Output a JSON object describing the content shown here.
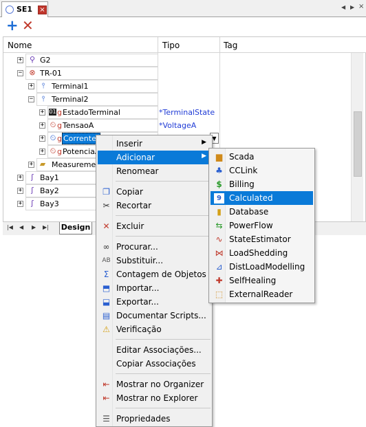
{
  "document_tab": {
    "title": "SE1",
    "close": "×"
  },
  "toolbar": {
    "add": "+",
    "delete": "✕"
  },
  "grid": {
    "columns": [
      "Nome",
      "Tipo",
      "Tag"
    ],
    "rows": [
      {
        "name": "G2",
        "tipo": "",
        "expander": "+"
      },
      {
        "name": "TR-01",
        "tipo": "",
        "expander": "−"
      },
      {
        "name": "Terminal1",
        "tipo": "",
        "expander": "+"
      },
      {
        "name": "Terminal2",
        "tipo": "",
        "expander": "−"
      },
      {
        "name": "EstadoTerminal",
        "tipo": "*TerminalState",
        "expander": "+",
        "prefix": "g"
      },
      {
        "name": "TensaoA",
        "tipo": "*VoltageA",
        "expander": "+",
        "prefix": "g"
      },
      {
        "name": "CorrenteA",
        "tipo": "",
        "expander": "+",
        "prefix": "g"
      },
      {
        "name": "PotenciaA",
        "tipo": "",
        "expander": "+",
        "prefix": "g"
      },
      {
        "name": "Measurement",
        "tipo": "",
        "expander": "+"
      },
      {
        "name": "Bay1",
        "tipo": "",
        "expander": "+"
      },
      {
        "name": "Bay2",
        "tipo": "",
        "expander": "+"
      },
      {
        "name": "Bay3",
        "tipo": "",
        "expander": "+"
      }
    ]
  },
  "bottom_tabs": {
    "design": "Design"
  },
  "context_menu": {
    "items": [
      {
        "label": "Inserir",
        "icon": "none",
        "submenu": true
      },
      {
        "label": "Adicionar",
        "icon": "none",
        "submenu": true,
        "highlighted": true
      },
      {
        "label": "Renomear",
        "icon": "none"
      },
      {
        "label": "Copiar",
        "icon": "copy-icon"
      },
      {
        "label": "Recortar",
        "icon": "scissors-icon"
      },
      {
        "label": "Excluir",
        "icon": "delete-x-icon"
      },
      {
        "label": "Procurar...",
        "icon": "binoculars-icon"
      },
      {
        "label": "Substituir...",
        "icon": "replace-icon"
      },
      {
        "label": "Contagem de Objetos",
        "icon": "sigma-icon"
      },
      {
        "label": "Importar...",
        "icon": "import-icon"
      },
      {
        "label": "Exportar...",
        "icon": "export-icon"
      },
      {
        "label": "Documentar Scripts...",
        "icon": "book-icon"
      },
      {
        "label": "Verificação",
        "icon": "warning-check-icon"
      },
      {
        "label": "Editar Associações...",
        "icon": "none"
      },
      {
        "label": "Copiar Associações",
        "icon": "none"
      },
      {
        "label": "Mostrar no Organizer",
        "icon": "organizer-icon"
      },
      {
        "label": "Mostrar no Explorer",
        "icon": "explorer-icon"
      },
      {
        "label": "Propriedades",
        "icon": "properties-icon"
      }
    ]
  },
  "add_submenu": {
    "items": [
      {
        "label": "Scada",
        "icon": "scada-icon"
      },
      {
        "label": "CCLink",
        "icon": "cclink-icon"
      },
      {
        "label": "Billing",
        "icon": "dollar-icon"
      },
      {
        "label": "Calculated",
        "icon": "calculated-icon",
        "highlighted": true
      },
      {
        "label": "Database",
        "icon": "database-icon"
      },
      {
        "label": "PowerFlow",
        "icon": "powerflow-icon"
      },
      {
        "label": "StateEstimator",
        "icon": "state-estimator-icon"
      },
      {
        "label": "LoadShedding",
        "icon": "load-shedding-icon"
      },
      {
        "label": "DistLoadModelling",
        "icon": "dist-load-icon"
      },
      {
        "label": "SelfHealing",
        "icon": "self-healing-icon"
      },
      {
        "label": "ExternalReader",
        "icon": "external-reader-icon"
      }
    ]
  },
  "colors": {
    "highlight": "#0a7ad8",
    "tipo_text": "#1f3bd6",
    "selected_cell": "#0a7ad8"
  }
}
